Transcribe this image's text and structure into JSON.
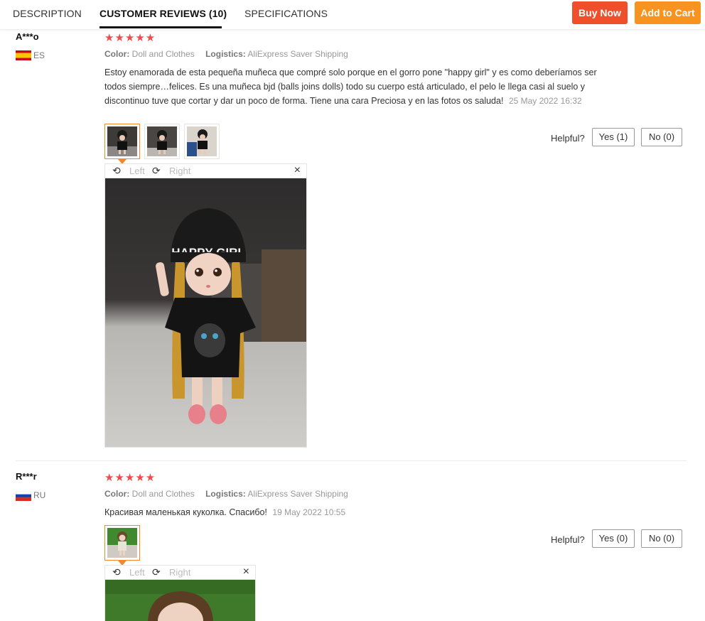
{
  "tabs": [
    {
      "label": "DESCRIPTION"
    },
    {
      "label": "CUSTOMER REVIEWS (10)"
    },
    {
      "label": "SPECIFICATIONS"
    }
  ],
  "actions": {
    "buy_now": "Buy Now",
    "add_to_cart": "Add to Cart"
  },
  "viewer": {
    "left": "Left",
    "right": "Right",
    "close": "×"
  },
  "reviews": [
    {
      "name": "A***o",
      "country": "ES",
      "stars": "★★★★★",
      "color_label": "Color:",
      "color": "Doll and Clothes",
      "logistics_label": "Logistics:",
      "logistics": "AliExpress Saver Shipping",
      "text": "Estoy enamorada de esta pequeña muñeca que compré solo porque en el gorro pone \"happy girl\" y es como deberíamos ser todos siempre…felices. Es una muñeca bjd (balls joins dolls) todo su cuerpo está articulado, el pelo le llega casi al suelo y discontinuo tuve que cortar y dar un poco de forma. Tiene una cara Preciosa y en las fotos os saluda!",
      "date": "25 May 2022 16:32",
      "helpful": "Helpful?",
      "yes": "Yes (1)",
      "no": "No (0)"
    },
    {
      "name": "R***r",
      "country": "RU",
      "stars": "★★★★★",
      "color_label": "Color:",
      "color": "Doll and Clothes",
      "logistics_label": "Logistics:",
      "logistics": "AliExpress Saver Shipping",
      "text": "Красивая маленькая куколка. Спасибо!",
      "date": "19 May 2022 10:55",
      "helpful": "Helpful?",
      "yes": "Yes (0)",
      "no": "No (0)"
    }
  ],
  "hat_text": "HAPPY GIRL",
  "colors": {
    "buy": "#ef4f2b",
    "cart": "#f7931e",
    "star": "#f2494b",
    "selected": "#f08a2c"
  }
}
